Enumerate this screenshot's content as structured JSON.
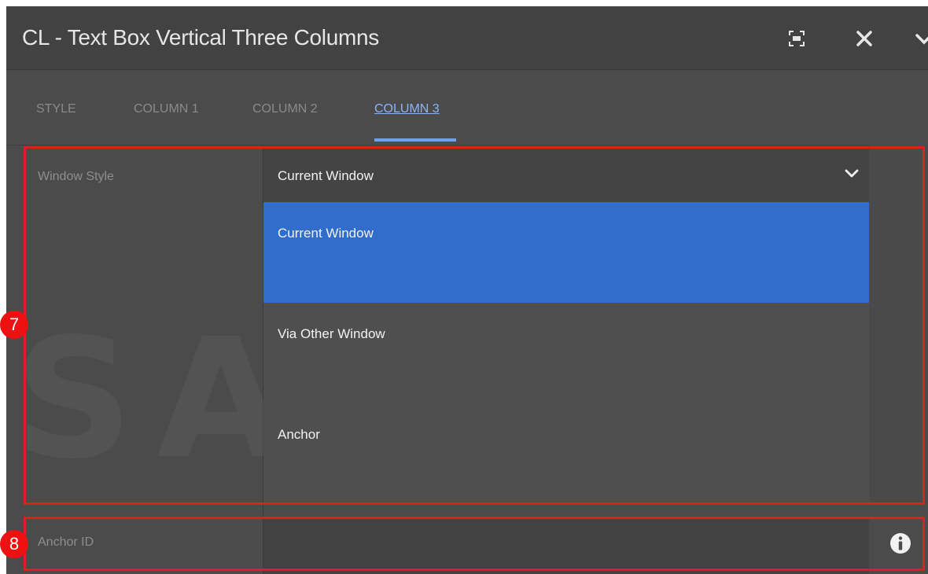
{
  "dialog": {
    "title": "CL - Text Box Vertical Three Columns",
    "icons": [
      "fullscreen-icon",
      "close-icon",
      "chevron-down-icon"
    ]
  },
  "tabs": [
    {
      "label": "STYLE",
      "active": false
    },
    {
      "label": "COLUMN 1",
      "active": false
    },
    {
      "label": "COLUMN 2",
      "active": false
    },
    {
      "label": "COLUMN 3",
      "active": true
    }
  ],
  "window_style": {
    "label": "Window Style",
    "selected_value": "Current Window",
    "options": [
      {
        "label": "Current Window",
        "selected": true
      },
      {
        "label": "Via Other Window",
        "selected": false
      },
      {
        "label": "Anchor",
        "selected": false
      }
    ]
  },
  "anchor_id": {
    "label": "Anchor ID",
    "value": "",
    "icon": "info-icon"
  },
  "watermark": "SAMSUNG",
  "annotations": [
    {
      "number": "7",
      "color": "#ee1111"
    },
    {
      "number": "8",
      "color": "#ee1111"
    }
  ],
  "colors": {
    "accent": "#316dca",
    "tab_active": "#8ab4f8",
    "highlight": "#e01e1e"
  }
}
